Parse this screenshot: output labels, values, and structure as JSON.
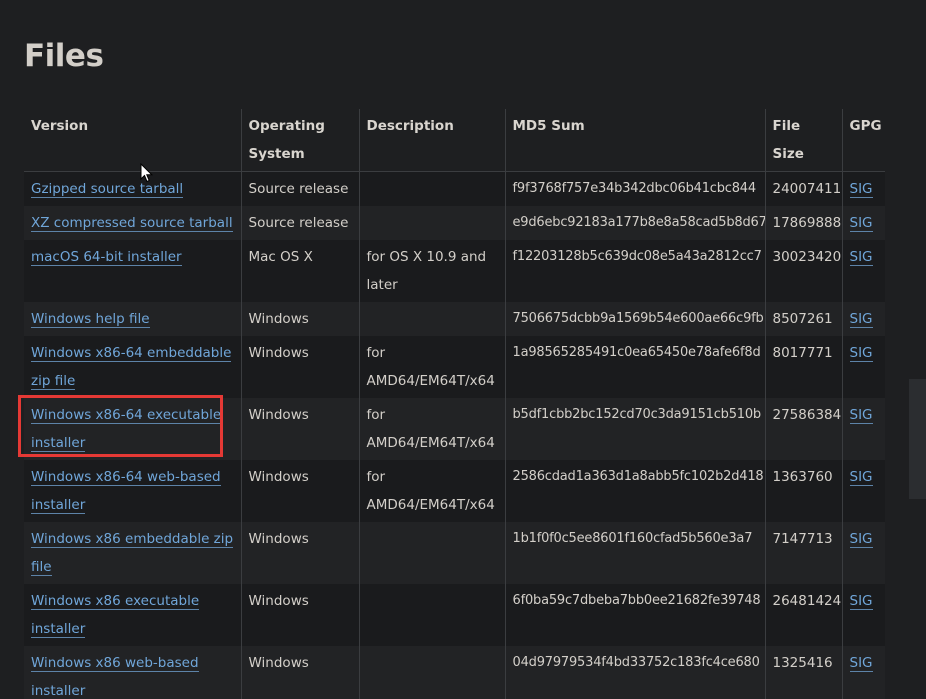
{
  "page": {
    "title": "Files"
  },
  "table": {
    "headers": {
      "version": "Version",
      "os": "Operating System",
      "description": "Description",
      "md5": "MD5 Sum",
      "size": "File Size",
      "gpg": "GPG"
    },
    "rows": [
      {
        "version": "Gzipped source tarball",
        "os": "Source release",
        "description": "",
        "md5": "f9f3768f757e34b342dbc06b41cbc844",
        "size": "24007411",
        "gpg": "SIG"
      },
      {
        "version": "XZ compressed source tarball",
        "os": "Source release",
        "description": "",
        "md5": "e9d6ebc92183a177b8e8a58cad5b8d67",
        "size": "17869888",
        "gpg": "SIG"
      },
      {
        "version": "macOS 64-bit installer",
        "os": "Mac OS X",
        "description": "for OS X 10.9 and later",
        "md5": "f12203128b5c639dc08e5a43a2812cc7",
        "size": "30023420",
        "gpg": "SIG"
      },
      {
        "version": "Windows help file",
        "os": "Windows",
        "description": "",
        "md5": "7506675dcbb9a1569b54e600ae66c9fb",
        "size": "8507261",
        "gpg": "SIG"
      },
      {
        "version": "Windows x86-64 embeddable zip file",
        "os": "Windows",
        "description": "for AMD64/EM64T/x64",
        "md5": "1a98565285491c0ea65450e78afe6f8d",
        "size": "8017771",
        "gpg": "SIG"
      },
      {
        "version": "Windows x86-64 executable installer",
        "os": "Windows",
        "description": "for AMD64/EM64T/x64",
        "md5": "b5df1cbb2bc152cd70c3da9151cb510b",
        "size": "27586384",
        "gpg": "SIG"
      },
      {
        "version": "Windows x86-64 web-based installer",
        "os": "Windows",
        "description": "for AMD64/EM64T/x64",
        "md5": "2586cdad1a363d1a8abb5fc102b2d418",
        "size": "1363760",
        "gpg": "SIG"
      },
      {
        "version": "Windows x86 embeddable zip file",
        "os": "Windows",
        "description": "",
        "md5": "1b1f0f0c5ee8601f160cfad5b560e3a7",
        "size": "7147713",
        "gpg": "SIG"
      },
      {
        "version": "Windows x86 executable installer",
        "os": "Windows",
        "description": "",
        "md5": "6f0ba59c7dbeba7bb0ee21682fe39748",
        "size": "26481424",
        "gpg": "SIG"
      },
      {
        "version": "Windows x86 web-based installer",
        "os": "Windows",
        "description": "",
        "md5": "04d97979534f4bd33752c183fc4ce680",
        "size": "1325416",
        "gpg": "SIG"
      }
    ]
  },
  "colors": {
    "background": "#1e1f21",
    "link": "#70a6d9",
    "highlight": "#e53935",
    "text": "#d3cfc9"
  },
  "icons": {
    "cursor": "mouse-pointer-icon"
  }
}
